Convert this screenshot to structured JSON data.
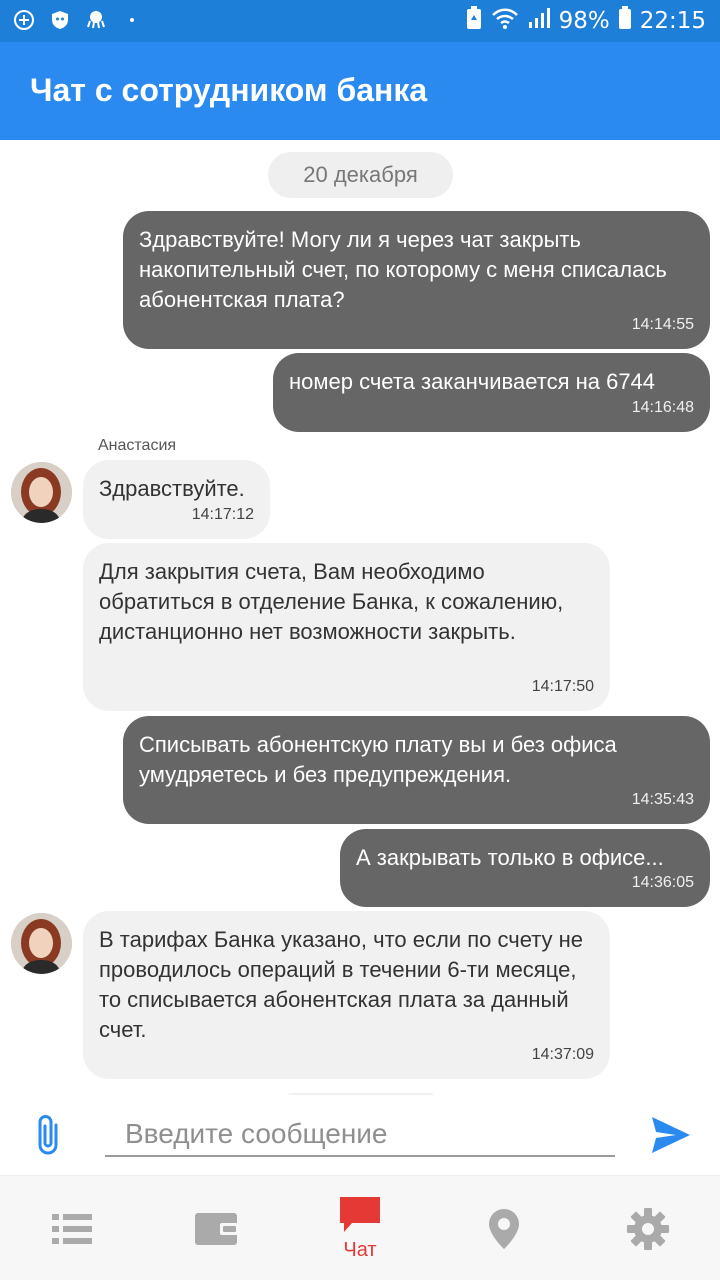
{
  "status_bar": {
    "battery_percent": "98%",
    "time": "22:15"
  },
  "header": {
    "title": "Чат с сотрудником банка"
  },
  "chat": {
    "date_separator": "20 декабря",
    "messages": [
      {
        "direction": "out",
        "text": "Здравствуйте! Могу ли я через чат закрыть накопительный счет, по которому с меня списалась абонентская плата?",
        "time": "14:14:55"
      },
      {
        "direction": "out",
        "text": "номер счета заканчивается на 6744",
        "time": "14:16:48"
      },
      {
        "direction": "in",
        "sender": "Анастасия",
        "text": "Здравствуйте.",
        "time": "14:17:12"
      },
      {
        "direction": "in",
        "text": "Для закрытия счета, Вам необходимо обратиться в отделение Банка, к сожалению, дистанционно нет возможности закрыть.",
        "time": "14:17:50"
      },
      {
        "direction": "out",
        "text": "Списывать абонентскую плату вы и без офиса умудряетесь и без предупреждения.",
        "time": "14:35:43"
      },
      {
        "direction": "out",
        "text": "А закрывать только в офисе...",
        "time": "14:36:05"
      },
      {
        "direction": "in",
        "text": "В тарифах Банка указано, что если по счету не проводилось операций в течении 6-ти месяце, то списывается абонентская плата за данный счет.",
        "time": "14:37:09"
      }
    ]
  },
  "composer": {
    "placeholder": "Введите сообщение"
  },
  "bottom_nav": {
    "items": [
      {
        "icon": "list-icon",
        "label": ""
      },
      {
        "icon": "wallet-icon",
        "label": ""
      },
      {
        "icon": "chat-icon",
        "label": "Чат",
        "active": true
      },
      {
        "icon": "location-pin-icon",
        "label": ""
      },
      {
        "icon": "gear-icon",
        "label": ""
      }
    ]
  },
  "colors": {
    "status_bar": "#1e7fd9",
    "app_bar": "#2b8af0",
    "outgoing_bubble": "#666666",
    "incoming_bubble": "#f1f1f1",
    "accent_active": "#e53935",
    "send_icon": "#2b8af0",
    "inactive_icon": "#aaaaaa"
  }
}
